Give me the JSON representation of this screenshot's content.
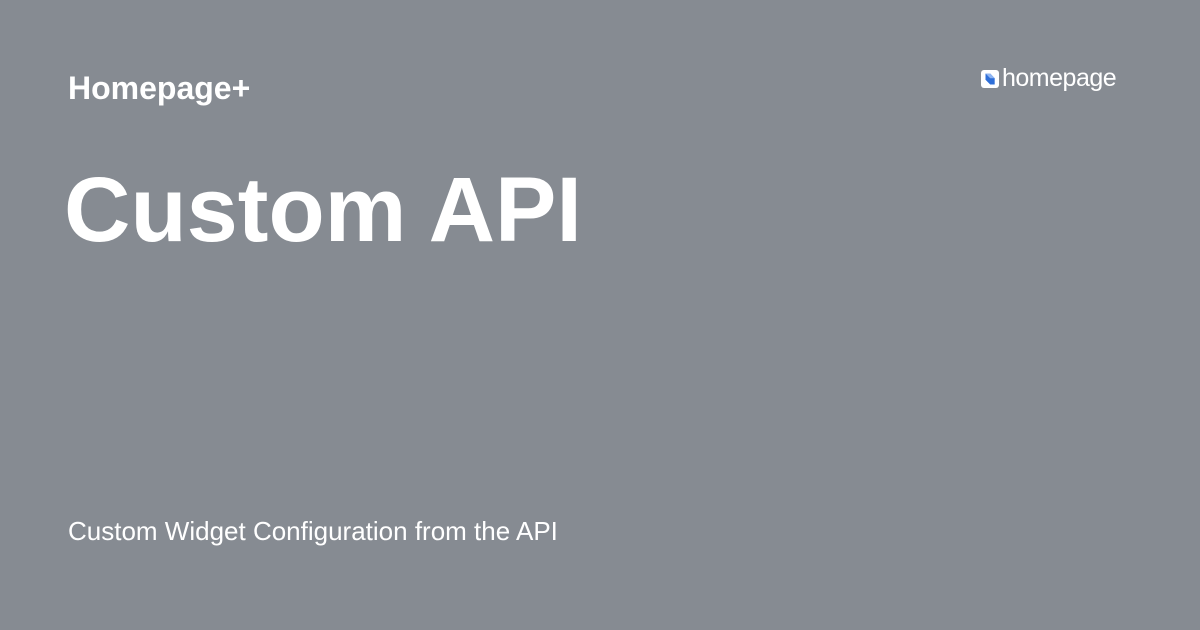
{
  "card": {
    "site_name": "Homepage+",
    "title": "Custom API",
    "description": "Custom Widget Configuration from the API",
    "background_color": "#868b92",
    "text_color": "#ffffff"
  },
  "logo": {
    "icon": "homepage-logo-icon",
    "wordmark": "homepage",
    "accent_color": "#2f6fd8"
  }
}
